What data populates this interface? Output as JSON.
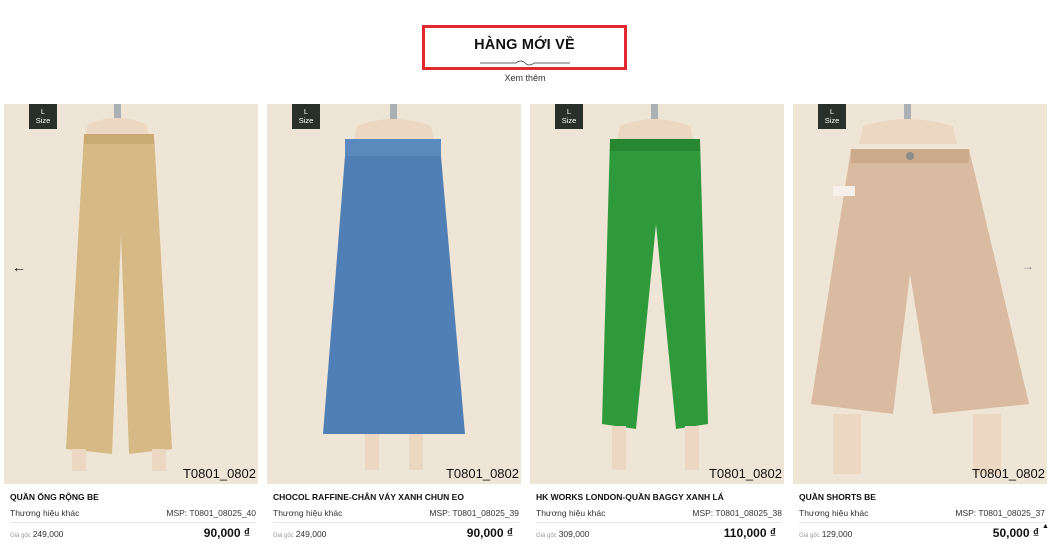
{
  "section": {
    "title": "HÀNG MỚI VỀ",
    "see_more": "Xem thêm"
  },
  "nav": {
    "prev_icon": "arrow-left-icon",
    "next_icon": "arrow-right-icon",
    "scroll_top_icon": "caret-up-icon"
  },
  "products": [
    {
      "size_badge": "L",
      "size_word": "Size",
      "sku_watermark": "T0801_0802",
      "name": "QUẦN ỐNG RỘNG BE",
      "brand": "Thương hiệu khác",
      "msp": "MSP: T0801_08025_40",
      "orig_label": "Giá gốc",
      "orig_price": "249,000",
      "price": "90,000 ₫",
      "color": "#d6b985"
    },
    {
      "size_badge": "L",
      "size_word": "Size",
      "sku_watermark": "T0801_0802",
      "name": "CHOCOL RAFFINE-CHÂN VÁY XANH CHUN EO",
      "brand": "Thương hiệu khác",
      "msp": "MSP: T0801_08025_39",
      "orig_label": "Giá gốc",
      "orig_price": "249,000",
      "price": "90,000 ₫",
      "color": "#4f7fb4"
    },
    {
      "size_badge": "L",
      "size_word": "Size",
      "sku_watermark": "T0801_0802",
      "name": "HK WORKS LONDON-QUẦN BAGGY XANH LÁ",
      "brand": "Thương hiệu khác",
      "msp": "MSP: T0801_08025_38",
      "orig_label": "Giá gốc",
      "orig_price": "309,000",
      "price": "110,000 ₫",
      "color": "#2f9a3c"
    },
    {
      "size_badge": "L",
      "size_word": "Size",
      "sku_watermark": "T0801_0802",
      "name": "QUẦN SHORTS BE",
      "brand": "Thương hiệu khác",
      "msp": "MSP: T0801_08025_37",
      "orig_label": "Giá gốc",
      "orig_price": "129,000",
      "price": "50,000 ₫",
      "color": "#d8bba0"
    }
  ]
}
